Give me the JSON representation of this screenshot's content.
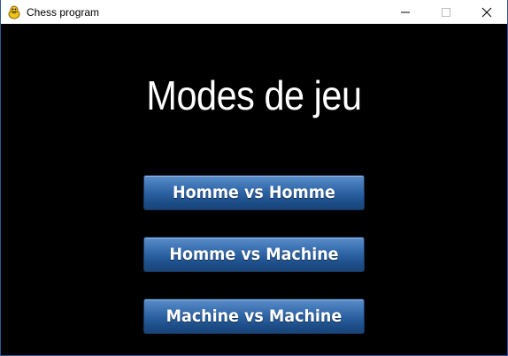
{
  "window": {
    "title": "Chess program",
    "icons": {
      "app": "python-snake-icon",
      "minimize": "minimize-icon",
      "maximize": "maximize-icon",
      "close": "close-icon"
    }
  },
  "main": {
    "heading": "Modes de jeu",
    "buttons": [
      {
        "label": "Homme vs Homme"
      },
      {
        "label": "Homme vs Machine"
      },
      {
        "label": "Machine vs Machine"
      }
    ]
  },
  "colors": {
    "background": "#000000",
    "button_top": "#5b8ec9",
    "button_bottom": "#1a4478",
    "text": "#ffffff"
  }
}
